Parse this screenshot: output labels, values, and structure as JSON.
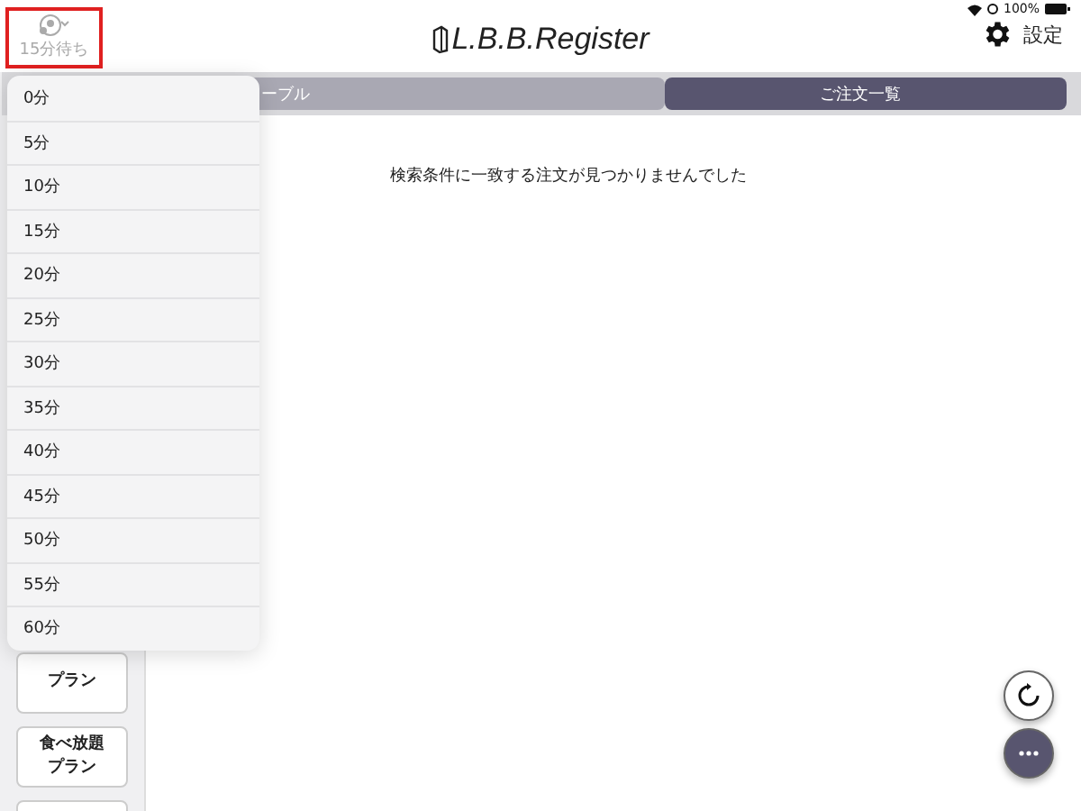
{
  "status_bar": {
    "battery": "100%"
  },
  "header": {
    "wait_button": {
      "label": "15分待ち"
    },
    "logo": "L.B.B.Register",
    "settings": "設定"
  },
  "tabs": [
    {
      "label": "ーブル",
      "selected": false
    },
    {
      "label": "ご注文一覧",
      "selected": true
    }
  ],
  "sidebar": {
    "items": [
      "プラン",
      "食べ放題プラン"
    ]
  },
  "empty_message": "検索条件に一致する注文が見つかりませんでした",
  "wait_menu": {
    "items": [
      "0分",
      "5分",
      "10分",
      "15分",
      "20分",
      "25分",
      "30分",
      "35分",
      "40分",
      "45分",
      "50分",
      "55分",
      "60分"
    ]
  }
}
